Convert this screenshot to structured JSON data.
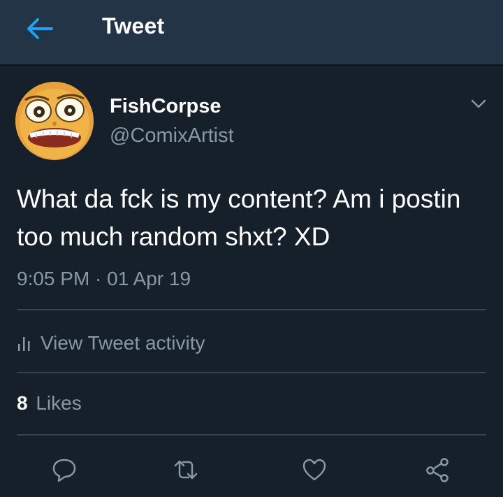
{
  "header": {
    "title": "Tweet",
    "back_icon": "arrow-left-icon"
  },
  "tweet": {
    "author_name": "FishCorpse",
    "author_handle": "@ComixArtist",
    "text": "What da fck is my content? Am i postin too much random shxt? XD",
    "timestamp": "9:05 PM · 01 Apr 19"
  },
  "activity": {
    "label": "View Tweet activity",
    "icon": "bar-chart-icon"
  },
  "stats": {
    "likes_count": "8",
    "likes_label": "Likes"
  },
  "actions": [
    "reply-icon",
    "retweet-icon",
    "like-icon",
    "share-icon"
  ],
  "colors": {
    "background": "#15202b",
    "header": "#243447",
    "accent": "#1da1f2",
    "secondary_text": "#8899a6",
    "divider": "#38444d"
  }
}
